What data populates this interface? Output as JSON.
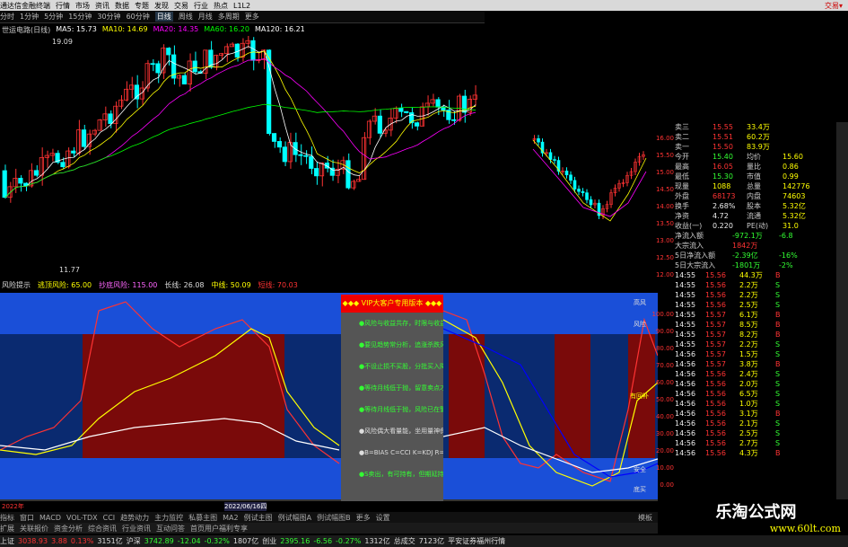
{
  "titlebar": {
    "app": "通达信金融终端",
    "menus": [
      "行情",
      "市场",
      "资讯",
      "数据",
      "专题",
      "发现",
      "交易",
      "行业",
      "热点",
      "L1L2"
    ],
    "right": "交易▾"
  },
  "toolbar": {
    "items": [
      "分时",
      "1分钟",
      "5分钟",
      "15分钟",
      "30分钟",
      "60分钟",
      "日线",
      "周线",
      "月线",
      "多周期",
      "更多"
    ],
    "active": "日线"
  },
  "main_legend": {
    "name": "世运电路(日线)",
    "items": [
      {
        "label": "MA5: 15.73",
        "color": "#ffffff"
      },
      {
        "label": "MA10: 14.69",
        "color": "#ffff00"
      },
      {
        "label": "MA20: 14.35",
        "color": "#ff00ff"
      },
      {
        "label": "MA60: 16.20",
        "color": "#00ff00"
      },
      {
        "label": "MA120: 16.21",
        "color": "#ffffff"
      }
    ]
  },
  "price_labels": {
    "high": "19.09",
    "low": "11.77"
  },
  "sub_header": {
    "items": [
      "风险提示",
      "逃顶风险: 65.00",
      "抄底风险: 115.00",
      "长线: 26.08",
      "中线: 50.09",
      "短线: 70.03"
    ]
  },
  "vip": {
    "title": "◆◆◆ VIP大客户专用版本 ◆◆◆",
    "lines": [
      "●风险与收益共存，时限与收益相关",
      "●要见趋势常分析，追涨杀跌风险大",
      "●不设止损不买股，分批买入降成本",
      "●等待月线低于抛，留意卖点才能赢",
      "●等待月线低于抛，风险已在警惕心",
      "●风险偶大看量能，坐用量神保平安",
      "●B=BIAS  C=CCI  K=KDJ  R=RSI",
      "●S卖出，有可持有，但期延持力能阻行为"
    ]
  },
  "sub_labels": {
    "top": "高风",
    "risk": "风险",
    "mid": "有回补",
    "safe": "安全",
    "deep": "底买",
    "dates": [
      "2022年",
      "2022/06/16四"
    ]
  },
  "axis": [
    "16.00",
    "15.50",
    "15.00",
    "14.50",
    "14.00",
    "13.50",
    "13.00",
    "12.50",
    "12.00"
  ],
  "subaxis": [
    "100.00",
    "90.00",
    "80.00",
    "70.00",
    "60.00",
    "50.00",
    "40.00",
    "30.00",
    "20.00",
    "10.00",
    "0.00"
  ],
  "quotes": [
    {
      "a": "卖三",
      "b": "15.55",
      "c": "33.4万",
      "cl": "red"
    },
    {
      "a": "卖二",
      "b": "15.51",
      "c": "60.2万",
      "cl": "red"
    },
    {
      "a": "卖一",
      "b": "15.50",
      "c": "83.9万",
      "cl": "red"
    },
    {
      "a": "今开",
      "b": "15.40",
      "c2": "均价",
      "d": "15.60",
      "cl": "grn"
    },
    {
      "a": "最高",
      "b": "16.05",
      "c2": "量比",
      "d": "0.86",
      "cl": "red"
    },
    {
      "a": "最低",
      "b": "15.30",
      "c2": "市值",
      "d": "0.99",
      "cl": "grn"
    },
    {
      "a": "现量",
      "b": "1088",
      "c2": "总量",
      "d": "142776",
      "cl": "yel"
    },
    {
      "a": "外盘",
      "b": "68173",
      "c2": "内盘",
      "d": "74603",
      "cl": "red"
    },
    {
      "a": "换手",
      "b": "2.68%",
      "c2": "股本",
      "d": "5.32亿",
      "cl": "wht"
    },
    {
      "a": "净资",
      "b": "4.72",
      "c2": "流通",
      "d": "5.32亿",
      "cl": "wht"
    },
    {
      "a": "收益(一)",
      "b": "0.220",
      "c2": "PE(动)",
      "d": "31.0",
      "cl": "wht"
    }
  ],
  "flows": [
    {
      "a": "净流入额",
      "b": "-972.1万",
      "c": "-6.8",
      "cl": "grn"
    },
    {
      "a": "大宗流入",
      "b": "1842万",
      "c": "",
      "cl": "red"
    },
    {
      "a": "5日净流入额",
      "b": "-2.39亿",
      "c": "-16%",
      "cl": "grn"
    },
    {
      "a": "5日大宗流入",
      "b": "-1801万",
      "c": "-2%",
      "cl": "grn"
    }
  ],
  "ticks": [
    {
      "t": "14:55",
      "p": "15.56",
      "v": "44.3万",
      "s": "B"
    },
    {
      "t": "14:55",
      "p": "15.56",
      "v": "2.2万",
      "s": "S"
    },
    {
      "t": "14:55",
      "p": "15.56",
      "v": "2.2万",
      "s": "S"
    },
    {
      "t": "14:55",
      "p": "15.56",
      "v": "2.5万",
      "s": "S"
    },
    {
      "t": "14:55",
      "p": "15.57",
      "v": "6.1万",
      "s": "B"
    },
    {
      "t": "14:55",
      "p": "15.57",
      "v": "8.5万",
      "s": "B"
    },
    {
      "t": "14:55",
      "p": "15.57",
      "v": "8.2万",
      "s": "B"
    },
    {
      "t": "14:55",
      "p": "15.57",
      "v": "2.2万",
      "s": "S"
    },
    {
      "t": "14:56",
      "p": "15.57",
      "v": "1.5万",
      "s": "S"
    },
    {
      "t": "14:56",
      "p": "15.57",
      "v": "3.8万",
      "s": "B"
    },
    {
      "t": "14:56",
      "p": "15.56",
      "v": "2.4万",
      "s": "S"
    },
    {
      "t": "14:56",
      "p": "15.56",
      "v": "2.0万",
      "s": "S"
    },
    {
      "t": "14:56",
      "p": "15.56",
      "v": "6.5万",
      "s": "S"
    },
    {
      "t": "14:56",
      "p": "15.56",
      "v": "1.0万",
      "s": "S"
    },
    {
      "t": "14:56",
      "p": "15.56",
      "v": "3.1万",
      "s": "B"
    },
    {
      "t": "14:56",
      "p": "15.56",
      "v": "2.1万",
      "s": "S"
    },
    {
      "t": "14:56",
      "p": "15.56",
      "v": "2.5万",
      "s": "S"
    },
    {
      "t": "14:56",
      "p": "15.56",
      "v": "2.7万",
      "s": "S"
    },
    {
      "t": "14:56",
      "p": "15.56",
      "v": "4.3万",
      "s": "B"
    }
  ],
  "bottom_tabs1": [
    "指标",
    "窗口",
    "MACD",
    "VOL-TDX",
    "CCI",
    "趋势动力",
    "主力监控",
    "私募主图",
    "MA2",
    "例试主图",
    "例试幅图A",
    "例试幅图B",
    "更多",
    "设置"
  ],
  "bottom_tabs2": [
    "扩展",
    "关联报价",
    "资金分析",
    "综合资讯",
    "行业资讯",
    "互动问答",
    "首页用户福利专享"
  ],
  "bottom_right": "模板",
  "status": [
    {
      "label": "上证",
      "color": "#ddd"
    },
    {
      "label": "3038.93",
      "color": "#f33"
    },
    {
      "label": "3.88",
      "color": "#f33"
    },
    {
      "label": "0.13%",
      "color": "#f33"
    },
    {
      "label": "3151亿",
      "color": "#ddd"
    },
    {
      "label": "沪深",
      "color": "#ddd"
    },
    {
      "label": "3742.89",
      "color": "#3f3"
    },
    {
      "label": "-12.04",
      "color": "#3f3"
    },
    {
      "label": "-0.32%",
      "color": "#3f3"
    },
    {
      "label": "1807亿",
      "color": "#ddd"
    },
    {
      "label": "创业",
      "color": "#ddd"
    },
    {
      "label": "2395.16",
      "color": "#3f3"
    },
    {
      "label": "-6.56",
      "color": "#3f3"
    },
    {
      "label": "-0.27%",
      "color": "#3f3"
    },
    {
      "label": "1312亿",
      "color": "#ddd"
    },
    {
      "label": "总成交",
      "color": "#ddd"
    },
    {
      "label": "7123亿",
      "color": "#ddd"
    },
    {
      "label": "平安证券福州行情",
      "color": "#ddd"
    }
  ],
  "watermark": {
    "cn": "乐淘公式网",
    "url": "www.60lt.com"
  },
  "colors": {
    "up": "#ff3333",
    "down": "#00ffff",
    "ma5": "#ffffff",
    "ma10": "#ffff00",
    "ma20": "#ff00ff",
    "ma60": "#00ff00",
    "sub_bg_blue": "#1a4fd8",
    "sub_bg_dark": "#0a2060",
    "sub_red": "#8b0000"
  }
}
